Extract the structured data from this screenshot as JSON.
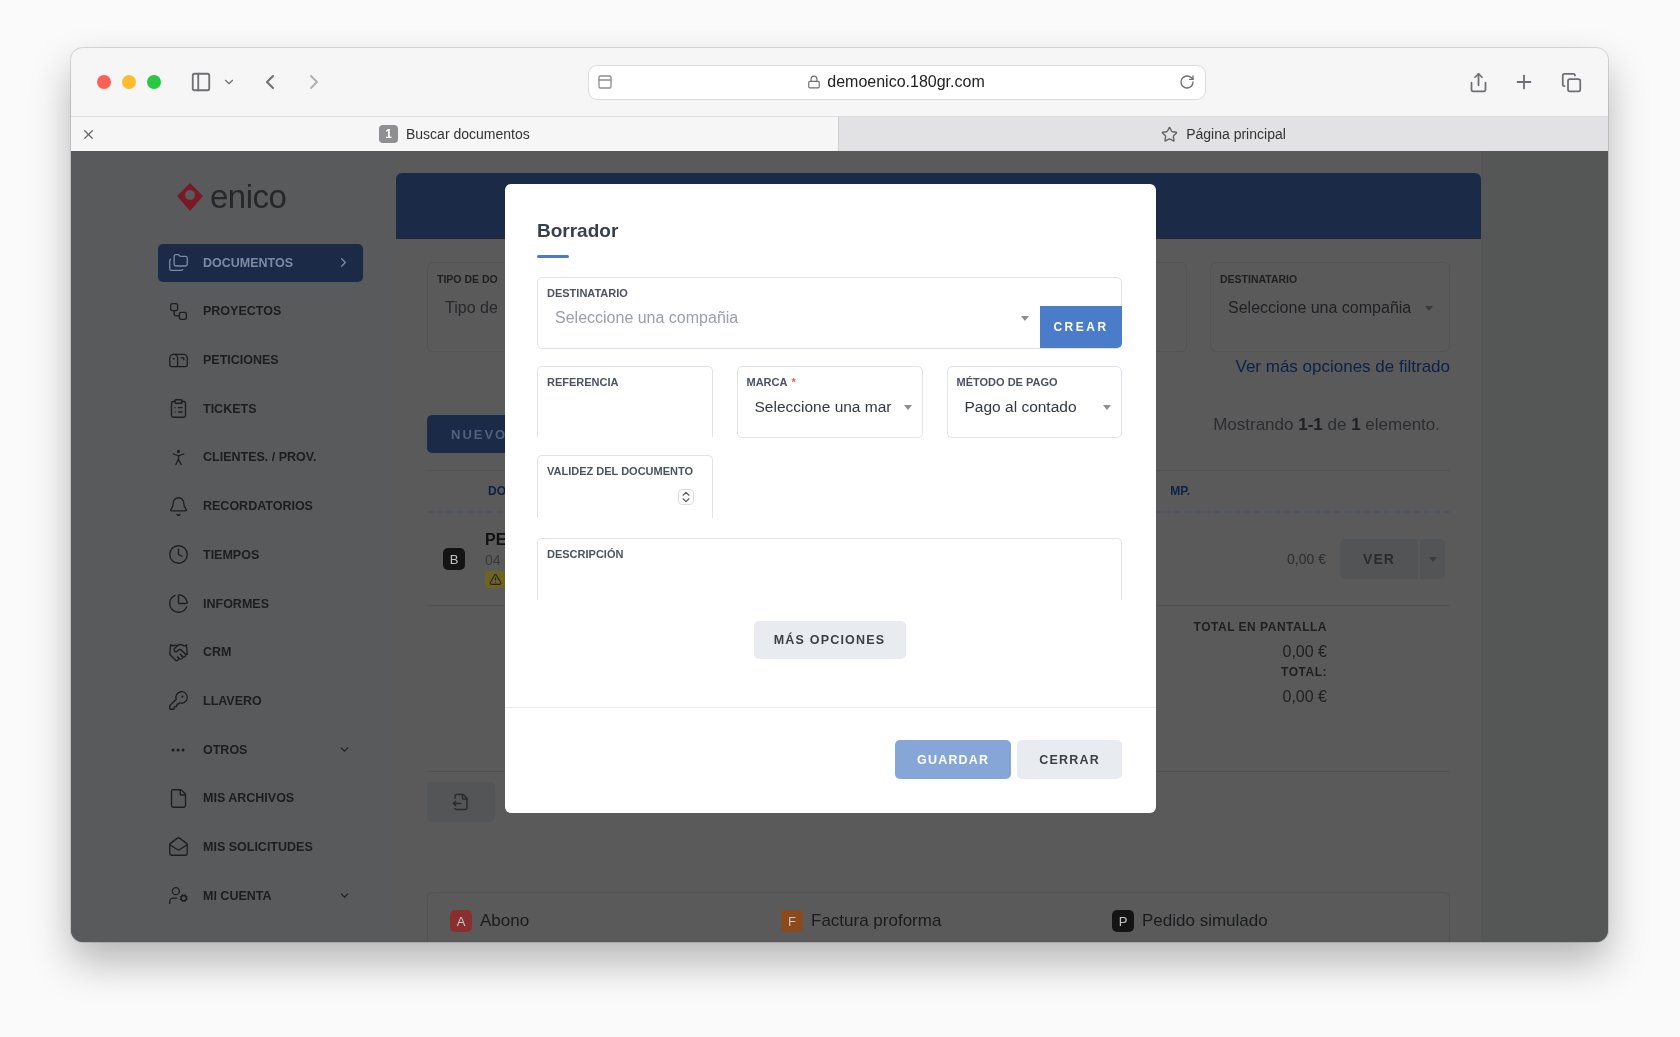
{
  "browser": {
    "url": "demoenico.180gr.com",
    "tabs": [
      {
        "label": "Buscar documentos",
        "badge": "1",
        "selected": true
      },
      {
        "label": "Página principal",
        "selected": false
      }
    ]
  },
  "sidebar": {
    "logo": "enico",
    "items": [
      {
        "label": "DOCUMENTOS",
        "selected": true,
        "kind": "submenu"
      },
      {
        "label": "PROYECTOS",
        "selected": false
      },
      {
        "label": "PETICIONES",
        "selected": false
      },
      {
        "label": "TICKETS",
        "selected": false
      },
      {
        "label": "CLIENTES. / PROV.",
        "selected": false
      },
      {
        "label": "RECORDATORIOS",
        "selected": false
      },
      {
        "label": "TIEMPOS",
        "selected": false
      },
      {
        "label": "INFORMES",
        "selected": false
      },
      {
        "label": "CRM",
        "selected": false
      },
      {
        "label": "LLAVERO",
        "selected": false
      },
      {
        "label": "OTROS",
        "selected": false,
        "kind": "group"
      },
      {
        "label": "MIS ARCHIVOS",
        "selected": false
      },
      {
        "label": "MIS SOLICITUDES",
        "selected": false
      },
      {
        "label": "MI CUENTA",
        "selected": false,
        "kind": "group"
      }
    ]
  },
  "page": {
    "filters": [
      {
        "label": "TIPO DE DO",
        "placeholder": "Tipo de"
      },
      {
        "label": "DESTINATARIO",
        "placeholder": "Seleccione una compañia"
      }
    ],
    "filter_link": "Ver más opciones de filtrado",
    "new_button": "NUEVO",
    "results": "Mostrando **1-1** de **1** elemento.",
    "columns": [
      "DO",
      "MP."
    ],
    "rows": [
      {
        "badge": "B",
        "title": "PE",
        "date": "04",
        "warning": true,
        "amount": "0,00 €",
        "action": "VER"
      }
    ],
    "totals": [
      {
        "label": "TOTAL EN PANTALLA",
        "value": "0,00 €"
      },
      {
        "label": "TOTAL:",
        "value": "0,00 €"
      }
    ],
    "legend": [
      {
        "letter": "A",
        "label": "Abono",
        "color": "#8a2f2f"
      },
      {
        "letter": "F",
        "label": "Factura proforma",
        "color": "#8a4a1c"
      },
      {
        "letter": "P",
        "label": "Pedido simulado",
        "color": "#141414"
      }
    ]
  },
  "modal": {
    "title": "Borrador",
    "fields": [
      {
        "kind": "company",
        "label": "DESTINATARIO",
        "placeholder": "Seleccione una compañia",
        "button": "CREAR"
      },
      {
        "kind": "text",
        "label": "REFERENCIA"
      },
      {
        "kind": "select",
        "label": "MARCA",
        "required_mark": "*",
        "value": "Seleccione una mar"
      },
      {
        "kind": "select",
        "label": "MÉTODO DE PAGO",
        "value": "Pago al contado"
      },
      {
        "kind": "number",
        "label": "VALIDEZ DEL DOCUMENTO"
      },
      {
        "kind": "textarea",
        "label": "DESCRIPCIÓN"
      }
    ],
    "more_button": "MÁS OPCIONES",
    "buttons": [
      {
        "kind": "primary",
        "label": "GUARDAR",
        "disabled": true
      },
      {
        "kind": "secondary",
        "label": "CERRAR",
        "disabled": false
      }
    ]
  }
}
